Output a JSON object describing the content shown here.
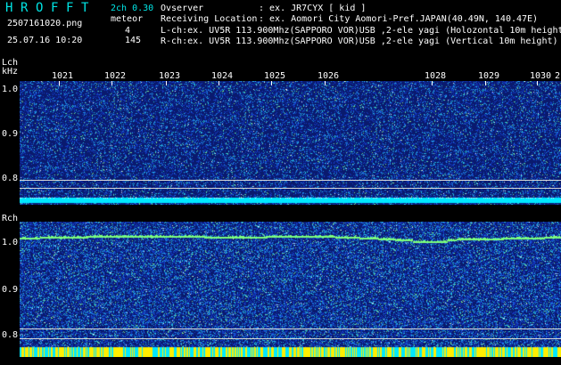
{
  "app": {
    "title_letters": [
      "H",
      "R",
      "O",
      "F",
      "F",
      "T"
    ],
    "version": "2ch 0.30",
    "meteor_label": "meteor",
    "file_name": "2507161020.png",
    "datetime": "25.07.16 10:20",
    "count_lch": "4",
    "count_rch": "145"
  },
  "info": {
    "observer_label": "Ovserver",
    "observer_value": ": ex. JR7CYX [ kid ]",
    "location_label": "Receiving Location",
    "location_value": ": ex. Aomori City Aomori-Pref.JAPAN(40.49N, 140.47E)",
    "lch_line": "L-ch:ex. UV5R 113.900Mhz(SAPPORO VOR)USB ,2-ele yagi (Holozontal 10m height)",
    "rch_line": "R-ch:ex. UV5R 113.900Mhz(SAPPORO VOR)USB ,2-ele yagi (Vertical 10m height)"
  },
  "lch_panel": {
    "channel_label": "Lch",
    "unit_label": "kHz",
    "y_labels": [
      "1.0",
      "0.9",
      "0.8"
    ]
  },
  "rch_panel": {
    "channel_label": "Rch",
    "y_labels": [
      "1.0",
      "0.9",
      "0.8"
    ]
  },
  "time_axis": {
    "ticks": [
      "1021",
      "1022",
      "1023",
      "1024",
      "1025",
      "1026",
      "1028",
      "1029",
      "1030",
      "2"
    ]
  },
  "colors": {
    "header_cyan": "#00e5e5",
    "spectrogram_bg": "#0a1a6e",
    "signal_green": "#7cff7c",
    "band_cyan": "#00e8ff",
    "band_yellow": "#ffee00"
  }
}
